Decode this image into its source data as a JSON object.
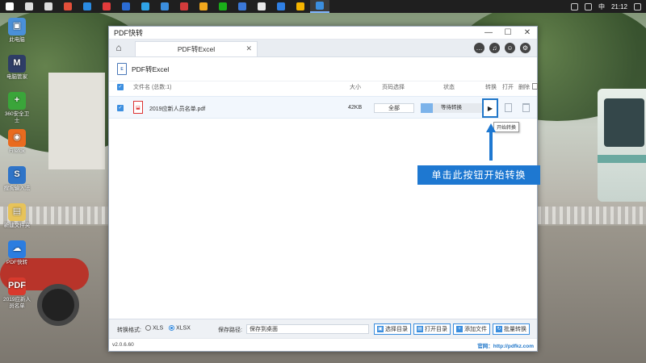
{
  "taskbar": {
    "icons": [
      {
        "name": "windows-start-icon",
        "color": "#ffffff"
      },
      {
        "name": "search-icon",
        "color": "#dddddd"
      },
      {
        "name": "task-view-icon",
        "color": "#dddddd"
      },
      {
        "name": "app-icon-1",
        "color": "#e34f3a"
      },
      {
        "name": "app-icon-2",
        "color": "#2a8be2"
      },
      {
        "name": "app-icon-3",
        "color": "#e33b3b"
      },
      {
        "name": "app-icon-4",
        "color": "#2b6cd4"
      },
      {
        "name": "app-icon-5",
        "color": "#2fa3e6"
      },
      {
        "name": "app-icon-6",
        "color": "#3b8ede"
      },
      {
        "name": "app-icon-7",
        "color": "#d23b3b"
      },
      {
        "name": "app-icon-8",
        "color": "#f2a81d"
      },
      {
        "name": "app-icon-9",
        "color": "#1aad19"
      },
      {
        "name": "app-icon-10",
        "color": "#3b78d8"
      },
      {
        "name": "app-icon-11",
        "color": "#e8e8e8"
      },
      {
        "name": "app-icon-12",
        "color": "#2f7fe3"
      },
      {
        "name": "app-icon-13",
        "color": "#f4b400"
      },
      {
        "name": "pdf-converter-taskbar-icon",
        "color": "#3b8ede"
      }
    ],
    "time": "21:12",
    "ime": "中"
  },
  "desktop": {
    "icons": [
      {
        "label": "此电脑",
        "glyph": "▣",
        "color": "#4a90d9"
      },
      {
        "label": "电脑管家",
        "glyph": "M",
        "color": "#2e3d66"
      },
      {
        "label": "360安全卫士",
        "glyph": "+",
        "color": "#3aa53a"
      },
      {
        "label": "Firefox",
        "glyph": "◉",
        "color": "#e96b1f"
      },
      {
        "label": "搜狗输入法",
        "glyph": "S",
        "color": "#2f74c8"
      },
      {
        "label": "新建文件夹",
        "glyph": "▤",
        "color": "#e7c35a"
      },
      {
        "label": "PDF快转",
        "glyph": "☁",
        "color": "#2c7de0"
      },
      {
        "label": "2019应新人员名单",
        "glyph": "PDF",
        "color": "#d83a2d"
      }
    ]
  },
  "window": {
    "title": "PDF快转",
    "controls": {
      "minimize": "—",
      "maximize": "☐",
      "close": "✕"
    },
    "tab_label": "PDF转Excel",
    "tab_close": "✕",
    "section_title": "PDF转Excel",
    "table": {
      "headers": {
        "name": "文件名 (总数:1)",
        "size": "大小",
        "pages": "页码选择",
        "status": "状态",
        "convert": "转换",
        "open": "打开",
        "delete": "删除"
      },
      "rows": [
        {
          "name": "2019应新人员名单.pdf",
          "size": "42KB",
          "pages": "全部",
          "status": "等待转换",
          "progress_percent": 20
        }
      ]
    },
    "tooltip": "开始转换",
    "callout": "单击此按钮开始转换",
    "bottom": {
      "format_label": "转换格式:",
      "format_xls": "XLS",
      "format_xlsx": "XLSX",
      "save_label": "保存路径:",
      "save_path": "保存到桌面",
      "buttons": {
        "select_dir": "选择目录",
        "open_dir": "打开目录",
        "add_file": "添加文件",
        "batch_convert": "批量转换"
      }
    },
    "status": {
      "version": "v2.0.6.60",
      "site": "官网：http://pdfkz.com"
    }
  },
  "colors": {
    "accent": "#1e78d1"
  }
}
